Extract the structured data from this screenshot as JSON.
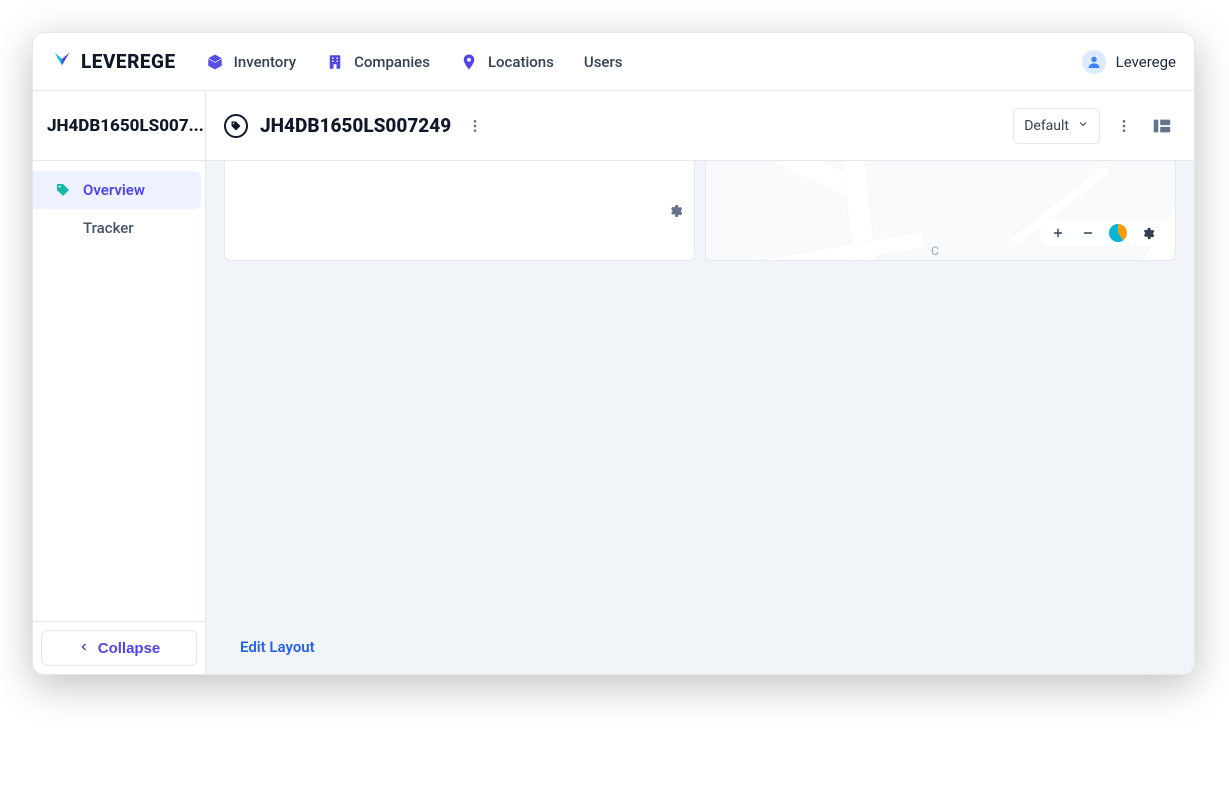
{
  "brand": "LEVEREGE",
  "nav": {
    "items": [
      {
        "icon": "cube-icon",
        "label": "Inventory"
      },
      {
        "icon": "building-icon",
        "label": "Companies"
      },
      {
        "icon": "pin-icon",
        "label": "Locations"
      },
      {
        "icon": null,
        "label": "Users"
      }
    ]
  },
  "user": {
    "name": "Leverege"
  },
  "sidebar": {
    "title": "JH4DB1650LS007...",
    "items": [
      {
        "label": "Overview",
        "active": true
      },
      {
        "label": "Tracker",
        "active": false
      }
    ],
    "collapse_label": "Collapse"
  },
  "content": {
    "title": "JH4DB1650LS007249",
    "layout_selector": "Default",
    "edit_layout_label": "Edit Layout",
    "map_partial_label": "C"
  },
  "colors": {
    "accent": "#4f46e5",
    "teal": "#14b8a6",
    "link": "#2563eb"
  }
}
